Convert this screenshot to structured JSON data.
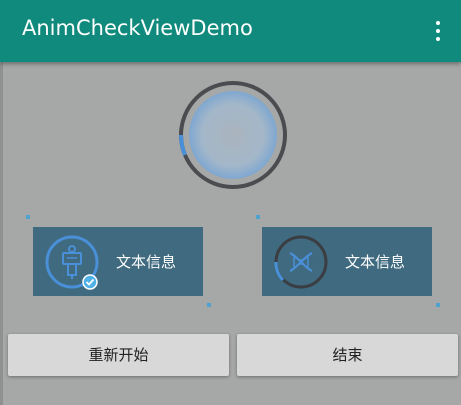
{
  "app": {
    "title": "AnimCheckViewDemo",
    "overflow_icon": "more-vert-icon"
  },
  "check_view": {
    "progress": 0.08,
    "colors": {
      "ring": "#4a4c50",
      "progress": "#4a90d9",
      "fill": "#9bbad6"
    }
  },
  "cards": [
    {
      "label": "文本信息",
      "icon": "person-sign-icon",
      "checked": true
    },
    {
      "label": "文本信息",
      "icon": "dna-icon",
      "checked": false,
      "progress": 0.3
    }
  ],
  "buttons": {
    "restart": "重新开始",
    "finish": "结束"
  },
  "colors": {
    "appbar": "#0f8a7c",
    "background": "#a6a8a8",
    "card": "#3f6a7f",
    "button": "#d8d8d8"
  }
}
